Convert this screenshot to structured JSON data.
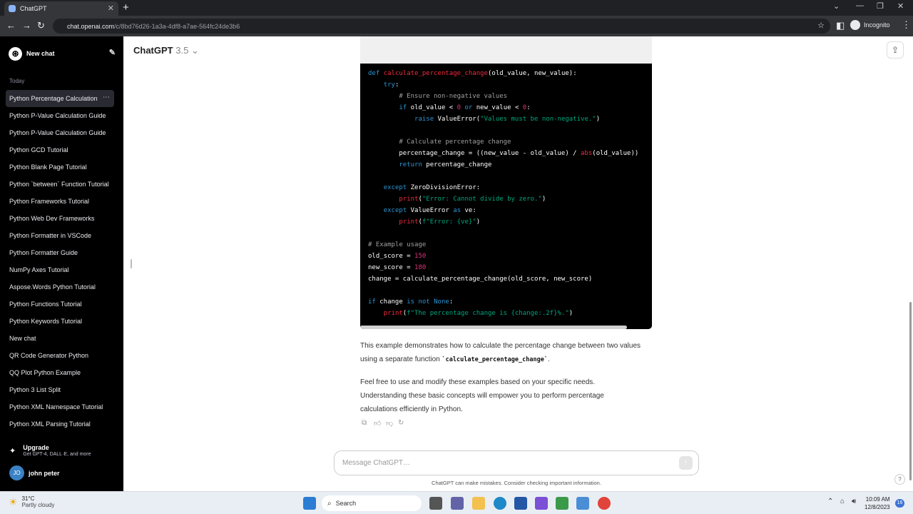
{
  "browser": {
    "tab_title": "ChatGPT",
    "url_domain": "chat.openai.com",
    "url_path": "/c/8bd76d26-1a3a-4df8-a7ae-564fc24de3b6",
    "profile": "Incognito"
  },
  "sidebar": {
    "new_chat": "New chat",
    "section_today": "Today",
    "items": [
      {
        "label": "Python Percentage Calculation"
      },
      {
        "label": "Python P-Value Calculation Guide"
      },
      {
        "label": "Python P-Value Calculation Guide"
      },
      {
        "label": "Python GCD Tutorial"
      },
      {
        "label": "Python Blank Page Tutorial"
      },
      {
        "label": "Python `between` Function Tutorial"
      },
      {
        "label": "Python Frameworks Tutorial"
      },
      {
        "label": "Python Web Dev Frameworks"
      },
      {
        "label": "Python Formatter in VSCode"
      },
      {
        "label": "Python Formatter Guide"
      },
      {
        "label": "NumPy Axes Tutorial"
      },
      {
        "label": "Aspose.Words Python Tutorial"
      },
      {
        "label": "Python Functions Tutorial"
      },
      {
        "label": "Python Keywords Tutorial"
      },
      {
        "label": "New chat"
      },
      {
        "label": "QR Code Generator Python"
      },
      {
        "label": "QQ Plot Python Example"
      },
      {
        "label": "Python 3 List Split"
      },
      {
        "label": "Python XML Namespace Tutorial"
      },
      {
        "label": "Python XML Parsing Tutorial"
      }
    ],
    "upgrade_title": "Upgrade",
    "upgrade_sub": "Get GPT-4, DALL·E, and more",
    "user_initials": "JO",
    "user_name": "john peter"
  },
  "header": {
    "model": "ChatGPT",
    "version": "3.5"
  },
  "code_lines": [
    [
      {
        "c": "kw",
        "t": "def "
      },
      {
        "c": "fn",
        "t": "calculate_percentage_change"
      },
      {
        "c": "",
        "t": "(old_value, new_value):"
      }
    ],
    [
      {
        "c": "",
        "t": "    "
      },
      {
        "c": "kw",
        "t": "try"
      },
      {
        "c": "",
        "t": ":"
      }
    ],
    [
      {
        "c": "cm",
        "t": "        # Ensure non-negative values"
      }
    ],
    [
      {
        "c": "",
        "t": "        "
      },
      {
        "c": "kw",
        "t": "if"
      },
      {
        "c": "",
        "t": " old_value < "
      },
      {
        "c": "nm",
        "t": "0"
      },
      {
        "c": "",
        "t": " "
      },
      {
        "c": "kw",
        "t": "or"
      },
      {
        "c": "",
        "t": " new_value < "
      },
      {
        "c": "nm",
        "t": "0"
      },
      {
        "c": "",
        "t": ":"
      }
    ],
    [
      {
        "c": "",
        "t": "            "
      },
      {
        "c": "kw",
        "t": "raise"
      },
      {
        "c": "",
        "t": " ValueError("
      },
      {
        "c": "st",
        "t": "\"Values must be non-negative.\""
      },
      {
        "c": "",
        "t": ")"
      }
    ],
    [
      {
        "c": "",
        "t": ""
      }
    ],
    [
      {
        "c": "cm",
        "t": "        # Calculate percentage change"
      }
    ],
    [
      {
        "c": "",
        "t": "        percentage_change = ((new_value - old_value) / "
      },
      {
        "c": "fn",
        "t": "abs"
      },
      {
        "c": "",
        "t": "(old_value))"
      }
    ],
    [
      {
        "c": "",
        "t": "        "
      },
      {
        "c": "kw",
        "t": "return"
      },
      {
        "c": "",
        "t": " percentage_change"
      }
    ],
    [
      {
        "c": "",
        "t": ""
      }
    ],
    [
      {
        "c": "",
        "t": "    "
      },
      {
        "c": "kw",
        "t": "except"
      },
      {
        "c": "",
        "t": " ZeroDivisionError:"
      }
    ],
    [
      {
        "c": "",
        "t": "        "
      },
      {
        "c": "fn",
        "t": "print"
      },
      {
        "c": "",
        "t": "("
      },
      {
        "c": "st",
        "t": "\"Error: Cannot divide by zero.\""
      },
      {
        "c": "",
        "t": ")"
      }
    ],
    [
      {
        "c": "",
        "t": "    "
      },
      {
        "c": "kw",
        "t": "except"
      },
      {
        "c": "",
        "t": " ValueError "
      },
      {
        "c": "kw",
        "t": "as"
      },
      {
        "c": "",
        "t": " ve:"
      }
    ],
    [
      {
        "c": "",
        "t": "        "
      },
      {
        "c": "fn",
        "t": "print"
      },
      {
        "c": "",
        "t": "("
      },
      {
        "c": "st",
        "t": "f\"Error: {ve}\""
      },
      {
        "c": "",
        "t": ")"
      }
    ],
    [
      {
        "c": "",
        "t": ""
      }
    ],
    [
      {
        "c": "cm",
        "t": "# Example usage"
      }
    ],
    [
      {
        "c": "",
        "t": "old_score = "
      },
      {
        "c": "nm",
        "t": "150"
      }
    ],
    [
      {
        "c": "",
        "t": "new_score = "
      },
      {
        "c": "nm",
        "t": "180"
      }
    ],
    [
      {
        "c": "",
        "t": "change = calculate_percentage_change(old_score, new_score)"
      }
    ],
    [
      {
        "c": "",
        "t": ""
      }
    ],
    [
      {
        "c": "kw",
        "t": "if"
      },
      {
        "c": "",
        "t": " change "
      },
      {
        "c": "kw",
        "t": "is not None"
      },
      {
        "c": "",
        "t": ":"
      }
    ],
    [
      {
        "c": "",
        "t": "    "
      },
      {
        "c": "fn",
        "t": "print"
      },
      {
        "c": "",
        "t": "("
      },
      {
        "c": "st",
        "t": "f\"The percentage change is {change:.2f}%.\""
      },
      {
        "c": "",
        "t": ")"
      }
    ]
  ],
  "answer": {
    "p1_before": "This example demonstrates how to calculate the percentage change between two values using a separate function ",
    "p1_code": "`calculate_percentage_change`",
    "p1_after": ".",
    "p2": "Feel free to use and modify these examples based on your specific needs. Understanding these basic concepts will empower you to perform percentage calculations efficiently in Python."
  },
  "composer": {
    "placeholder": "Message ChatGPT…",
    "disclaimer": "ChatGPT can make mistakes. Consider checking important information."
  },
  "taskbar": {
    "temperature": "31°C",
    "weather": "Partly cloudy",
    "search": "Search",
    "time": "10:09 AM",
    "date": "12/8/2023",
    "notifications": "16"
  }
}
